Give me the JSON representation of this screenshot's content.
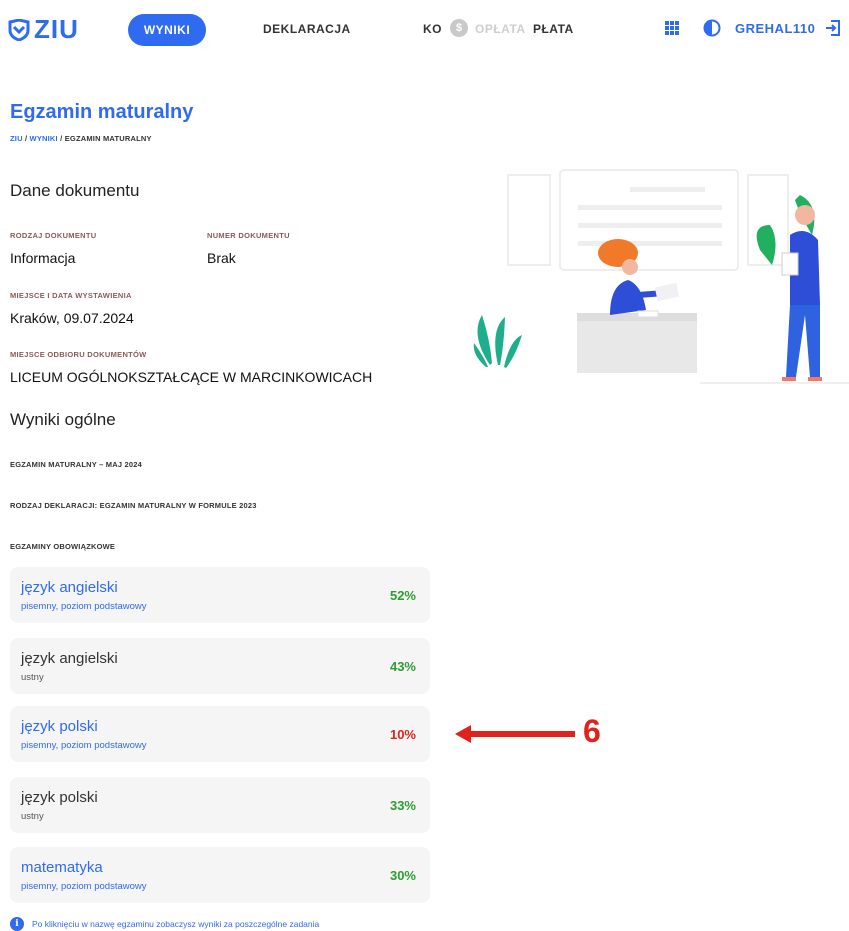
{
  "header": {
    "logo_text": "ZIU",
    "nav_active": "WYNIKI",
    "nav_deklaracja": "DEKLARACJA",
    "nav_ko": "KO",
    "nav_oplata_faded": "OPŁATA",
    "nav_oplata_tail": "PŁATA",
    "coin_symbol": "$",
    "username": "GREHAL110",
    "icons": [
      "logo-shield-icon",
      "apps-grid-icon",
      "contrast-icon",
      "logout-icon",
      "coin-icon"
    ],
    "accent_color": "#2f6bf0"
  },
  "page": {
    "title": "Egzamin maturalny",
    "breadcrumb": {
      "root": "ZIU",
      "sep1": " / ",
      "level1": "WYNIKI",
      "sep2": " / ",
      "current": "EGZAMIN MATURALNY"
    }
  },
  "document": {
    "section_title": "Dane dokumentu",
    "type_label": "RODZAJ DOKUMENTU",
    "type_value": "Informacja",
    "number_label": "NUMER DOKUMENTU",
    "number_value": "Brak",
    "place_date_label": "MIEJSCE I DATA WYSTAWIENIA",
    "place_date_value": "Kraków, 09.07.2024",
    "pickup_label": "MIEJSCE ODBIORU DOKUMENTÓW",
    "pickup_value": "LICEUM OGÓLNOKSZTAŁCĄCE W MARCINKOWICACH"
  },
  "results": {
    "section_title": "Wyniki ogólne",
    "session": "EGZAMIN MATURALNY – MAJ 2024",
    "declaration": "RODZAJ DEKLARACJI: EGZAMIN MATURALNY W FORMULE 2023",
    "mandatory_label": "EGZAMINY OBOWIĄZKOWE",
    "exams": [
      {
        "name": "język angielski",
        "sub": "pisemny, poziom podstawowy",
        "score": "52%",
        "link": true,
        "status": "pass"
      },
      {
        "name": "język angielski",
        "sub": "ustny",
        "score": "43%",
        "link": false,
        "status": "pass"
      },
      {
        "name": "język polski",
        "sub": "pisemny, poziom podstawowy",
        "score": "10%",
        "link": true,
        "status": "fail"
      },
      {
        "name": "język polski",
        "sub": "ustny",
        "score": "33%",
        "link": false,
        "status": "pass"
      },
      {
        "name": "matematyka",
        "sub": "pisemny, poziom podstawowy",
        "score": "30%",
        "link": true,
        "status": "pass"
      }
    ],
    "info_note": "Po kliknięciu w nazwę egzaminu zobaczysz wyniki za poszczególne zadania"
  },
  "annotation": {
    "number": "6",
    "color": "#e0221b"
  },
  "colors": {
    "pass": "#2e9c32",
    "fail": "#e0221b",
    "card_bg": "#f5f5f5"
  }
}
